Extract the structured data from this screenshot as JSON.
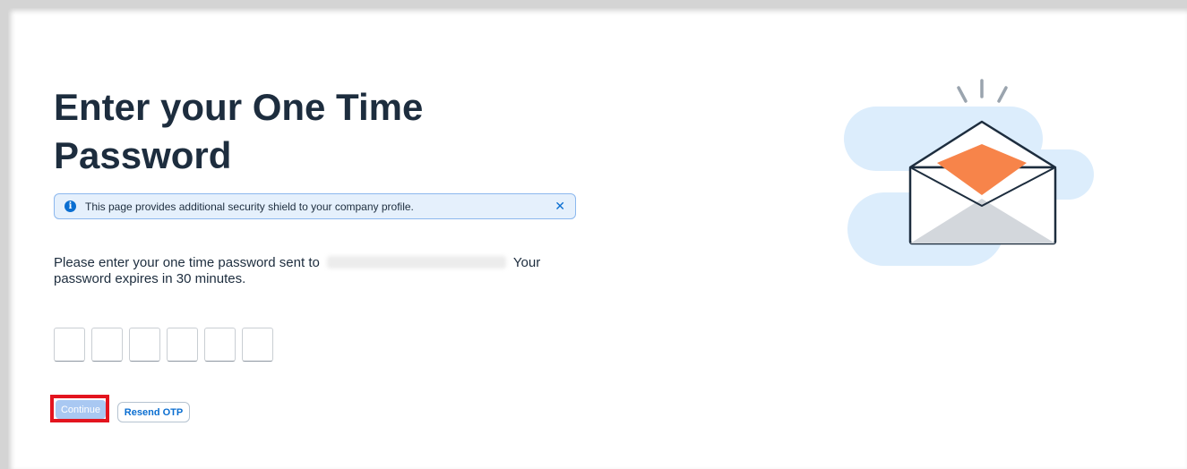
{
  "page": {
    "title": "Enter your One Time Password"
  },
  "notice": {
    "icon": "info-icon",
    "icon_glyph": "i",
    "text": "This page provides additional security shield to your company profile.",
    "close_icon": "close-icon",
    "close_glyph": "✕"
  },
  "instructions": {
    "before_email": "Please enter your one time password sent to",
    "email_redacted": "••••••••••••••••••••••",
    "after_email": "Your password expires in 30 minutes."
  },
  "otp": {
    "boxes": [
      "",
      "",
      "",
      "",
      "",
      ""
    ]
  },
  "actions": {
    "continue_label": "Continue",
    "resend_label": "Resend OTP"
  },
  "illustration": {
    "icon": "open-envelope-icon"
  },
  "colors": {
    "brand_blue": "#0a6ed1",
    "title_text": "#1d2d3e",
    "notice_bg": "#e5f0fc",
    "continue_disabled_bg": "#a9c8f2",
    "highlight_red": "#e3141e",
    "envelope_letter": "#f7844a",
    "cloud_blue": "#dcedfc"
  }
}
